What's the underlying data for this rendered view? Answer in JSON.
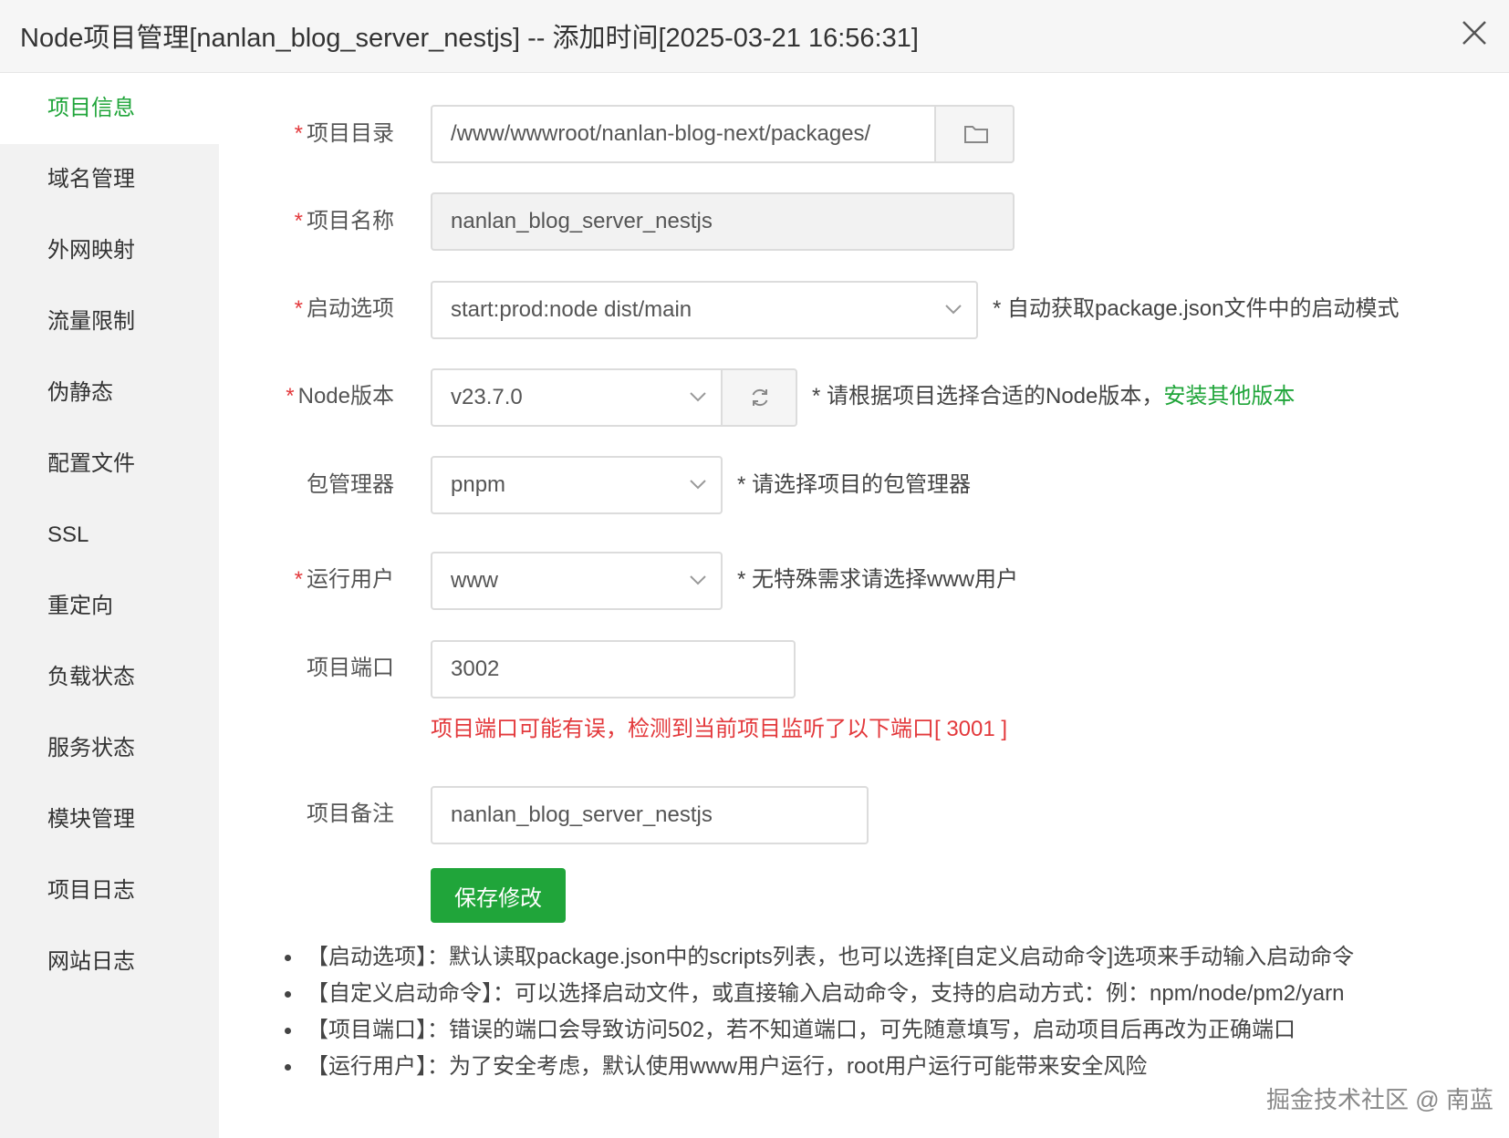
{
  "dialog": {
    "title": "Node项目管理[nanlan_blog_server_nestjs] -- 添加时间[2025-03-21 16:56:31]",
    "close_icon": "close-icon"
  },
  "sidebar": {
    "items": [
      {
        "label": "项目信息",
        "active": true
      },
      {
        "label": "域名管理"
      },
      {
        "label": "外网映射"
      },
      {
        "label": "流量限制"
      },
      {
        "label": "伪静态"
      },
      {
        "label": "配置文件"
      },
      {
        "label": "SSL"
      },
      {
        "label": "重定向"
      },
      {
        "label": "负载状态"
      },
      {
        "label": "服务状态"
      },
      {
        "label": "模块管理"
      },
      {
        "label": "项目日志"
      },
      {
        "label": "网站日志"
      }
    ]
  },
  "form": {
    "required_mark": "*",
    "project_dir": {
      "label": "项目目录",
      "value": "/www/wwwroot/nanlan-blog-next/packages/",
      "icon": "folder-icon"
    },
    "project_name": {
      "label": "项目名称",
      "value": "nanlan_blog_server_nestjs"
    },
    "start_option": {
      "label": "启动选项",
      "value": "start:prod:node dist/main",
      "hint": "* 自动获取package.json文件中的启动模式"
    },
    "node_version": {
      "label": "Node版本",
      "value": "v23.7.0",
      "icon": "refresh-icon",
      "hint": "* 请根据项目选择合适的Node版本，",
      "hint_link": "安装其他版本"
    },
    "package_manager": {
      "label": "包管理器",
      "value": "pnpm",
      "hint": "* 请选择项目的包管理器"
    },
    "run_user": {
      "label": "运行用户",
      "value": "www",
      "hint": "* 无特殊需求请选择www用户"
    },
    "port": {
      "label": "项目端口",
      "value": "3002",
      "error": "项目端口可能有误，检测到当前项目监听了以下端口[ 3001 ]"
    },
    "remark": {
      "label": "项目备注",
      "value": "nanlan_blog_server_nestjs"
    },
    "save_label": "保存修改"
  },
  "notes": [
    "【启动选项】：默认读取package.json中的scripts列表，也可以选择[自定义启动命令]选项来手动输入启动命令",
    "【自定义启动命令】：可以选择启动文件，或直接输入启动命令，支持的启动方式：例：npm/node/pm2/yarn",
    "【项目端口】：错误的端口会导致访问502，若不知道端口，可先随意填写，启动项目后再改为正确端口",
    "【运行用户】：为了安全考虑，默认使用www用户运行，root用户运行可能带来安全风险"
  ],
  "watermark": "掘金技术社区 @ 南蓝",
  "colors": {
    "accent": "#20a53a",
    "error": "#e3393c",
    "sidebar_bg": "#f2f2f2"
  }
}
